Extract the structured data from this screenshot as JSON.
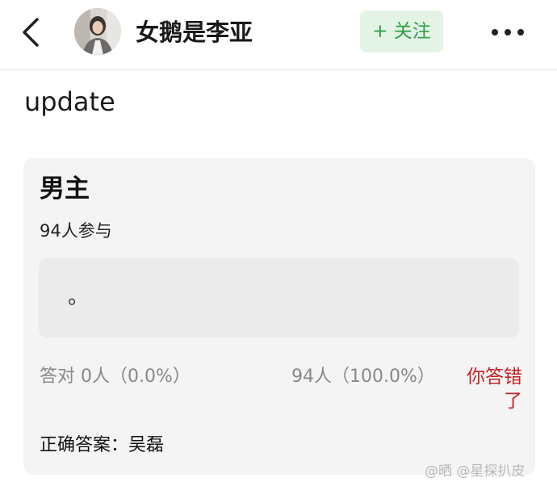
{
  "header": {
    "username": "女鹅是李亚",
    "follow_label": "+ 关注"
  },
  "post": {
    "text": "update"
  },
  "quiz": {
    "title": "男主",
    "participants": "94人参与",
    "option_text": "。",
    "correct_stat": "答对  0人（0.0%）",
    "wrong_stat": "94人（100.0%）",
    "your_answer": "你答错了",
    "correct_answer": "正确答案：吴磊"
  },
  "watermark": "@晒 @星探扒皮",
  "colors": {
    "follow_bg": "#e3f4e6",
    "follow_text": "#2f9e44",
    "wrong_answer": "#c72121",
    "card_bg": "#f4f4f4",
    "muted_text": "#888888"
  }
}
